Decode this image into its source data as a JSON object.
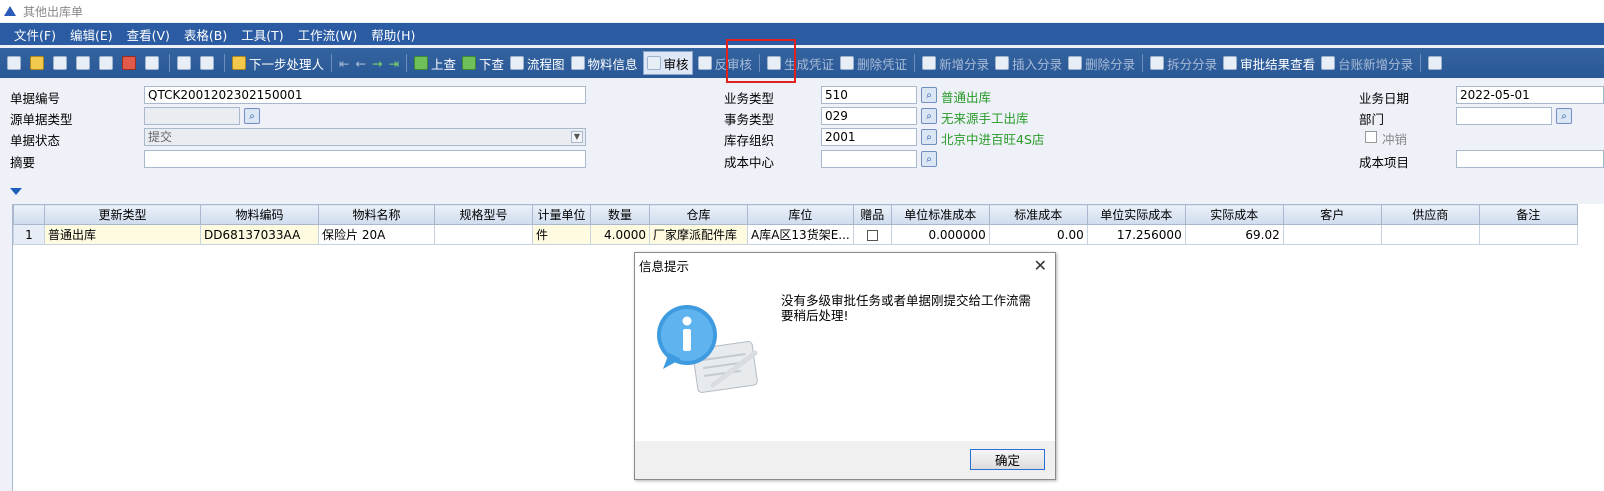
{
  "window": {
    "title": "其他出库单"
  },
  "menu": [
    "文件(F)",
    "编辑(E)",
    "查看(V)",
    "表格(B)",
    "工具(T)",
    "工作流(W)",
    "帮助(H)"
  ],
  "toolbar": {
    "next_handler": "下一步处理人",
    "prev_check": "上查",
    "next_check": "下查",
    "flowchart": "流程图",
    "material_info": "物料信息",
    "audit": "审核",
    "unaudit": "反审核",
    "gen_voucher": "生成凭证",
    "del_voucher": "删除凭证",
    "add_entry": "新增分录",
    "insert_entry": "插入分录",
    "delete_entry": "删除分录",
    "split_entry": "拆分分录",
    "audit_result": "审批结果查看",
    "ledger_add": "台账新增分录"
  },
  "form": {
    "doc_no_label": "单据编号",
    "doc_no": "QTCK2001202302150001",
    "src_type_label": "源单据类型",
    "src_type": "",
    "status_label": "单据状态",
    "status": "提交",
    "summary_label": "摘要",
    "summary": "",
    "biz_type_label": "业务类型",
    "biz_type_code": "510",
    "biz_type_name": "普通出库",
    "txn_type_label": "事务类型",
    "txn_type_code": "029",
    "txn_type_name": "无来源手工出库",
    "stock_org_label": "库存组织",
    "stock_org_code": "2001",
    "stock_org_name": "北京中进百旺4S店",
    "cost_center_label": "成本中心",
    "cost_center": "",
    "biz_date_label": "业务日期",
    "biz_date": "2022-05-01",
    "dept_label": "部门",
    "dept": "",
    "reverse_label": "冲销",
    "cost_item_label": "成本项目",
    "cost_item": ""
  },
  "grid": {
    "headers": [
      "更新类型",
      "物料编码",
      "物料名称",
      "规格型号",
      "计量单位",
      "数量",
      "仓库",
      "库位",
      "赠品",
      "单位标准成本",
      "标准成本",
      "单位实际成本",
      "实际成本",
      "客户",
      "供应商",
      "备注"
    ],
    "rows": [
      {
        "no": "1",
        "update_type": "普通出库",
        "material_code": "DD68137033AA",
        "material_name": "保险片 20A",
        "spec": "",
        "unit": "件",
        "qty": "4.0000",
        "warehouse": "厂家摩派配件库",
        "location": "A库A区13货架E...",
        "gift": false,
        "unit_std_cost": "0.000000",
        "std_cost": "0.00",
        "unit_act_cost": "17.256000",
        "act_cost": "69.02",
        "customer": "",
        "supplier": "",
        "remark": ""
      }
    ]
  },
  "dialog": {
    "title": "信息提示",
    "message": "没有多级审批任务或者单据刚提交给工作流需要稍后处理!",
    "ok": "确定"
  }
}
